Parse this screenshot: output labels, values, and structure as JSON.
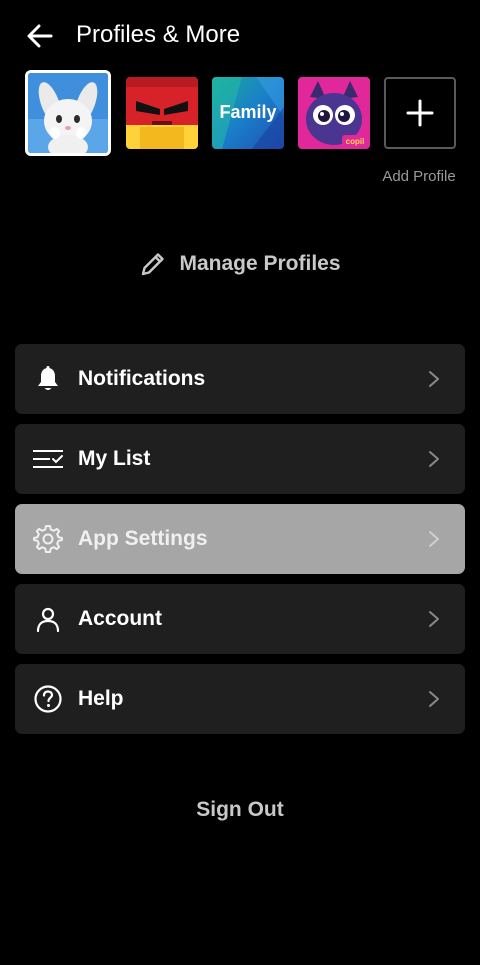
{
  "header": {
    "title": "Profiles & More",
    "back_icon": "back-arrow-icon"
  },
  "profiles": {
    "items": [
      {
        "name": "profile-1",
        "avatar": "white-bunny",
        "selected": true
      },
      {
        "name": "profile-2",
        "avatar": "red-angry-character",
        "selected": false
      },
      {
        "name": "profile-3",
        "avatar": "family",
        "label": "Family",
        "selected": false
      },
      {
        "name": "profile-4",
        "avatar": "purple-cat",
        "badge": "copil",
        "selected": false
      }
    ],
    "add_label": "Add Profile"
  },
  "manage": {
    "label": "Manage Profiles",
    "icon": "pencil-icon"
  },
  "menu": {
    "notifications": "Notifications",
    "my_list": "My List",
    "app_settings": "App Settings",
    "account": "Account",
    "help": "Help"
  },
  "sign_out": "Sign Out",
  "colors": {
    "background": "#000000",
    "menu_item": "#1f1f1f",
    "menu_item_active": "#a6a6a6",
    "muted_text": "#9a9a9a"
  }
}
